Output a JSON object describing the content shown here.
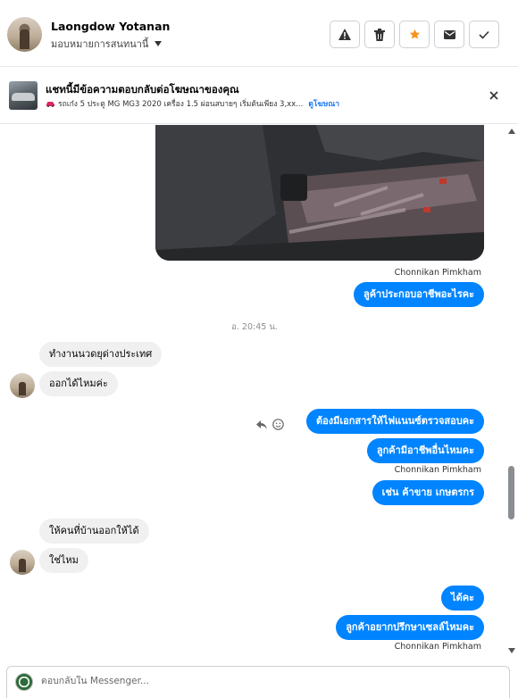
{
  "header": {
    "contact_name": "Laongdow Yotanan",
    "assign_label": "มอบหมายการสนทนานี้",
    "actions": [
      "report-icon",
      "trash-icon",
      "star-icon",
      "mail-icon",
      "check-icon"
    ],
    "accent_star": "#f7931e"
  },
  "ad_banner": {
    "title": "แชทนี้มีข้อความตอบกลับต่อโฆษณาของคุณ",
    "description": "รถเก๋ง 5 ประตู MG MG3 2020 เครื่อง 1.5 ผ่อนสบายๆ เริ่มต้นเพียง 3,xx...",
    "link_label": "ดูโฆษณา"
  },
  "messages": {
    "sender_1": "Chonnikan Pimkham",
    "out_1": "ลูค้าประกอบอาชีพอะไรคะ",
    "timestamp": "อ. 20:45 น.",
    "in_1": "ทำงานนวดยุด่างประเทศ",
    "in_2": "ออกได้ไหมค่ะ",
    "out_2": "ต้องมีเอกสารให้ไฟแนนซ์ตรวจสอบคะ",
    "out_3": "ลูกค้ามีอาชีพอื่นไหมคะ",
    "sender_2": "Chonnikan Pimkham",
    "out_4": "เช่น ค้าขาย เกษตรกร",
    "in_3": "ให้คนที่บ้านออกให้ได้",
    "in_4": "ใช่ไหม",
    "out_5": "ได้คะ",
    "out_6": "ลูกค้าอยากปรึกษาเซลล์ไหมคะ",
    "sender_3": "Chonnikan Pimkham"
  },
  "composer": {
    "placeholder": "ตอบกลับใน Messenger..."
  },
  "colors": {
    "outgoing_bubble": "#0084ff",
    "incoming_bubble": "#f0f0f0",
    "link": "#1877f2"
  }
}
